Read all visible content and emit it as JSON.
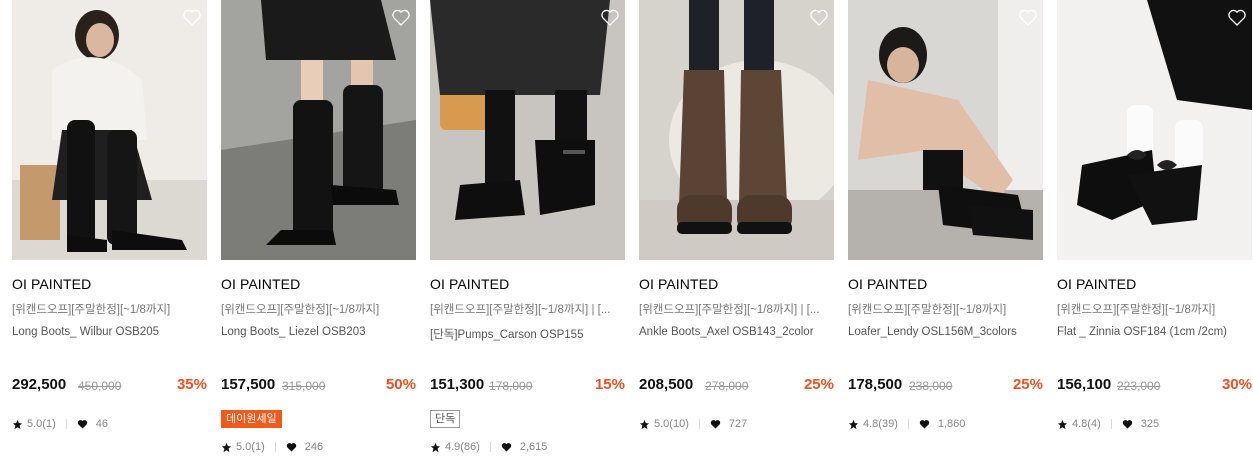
{
  "products": [
    {
      "brand": "OI PAINTED",
      "promo": "[위캔드오프][주말한정][~1/8까지]",
      "name": "Long Boots_ Wilbur OSB205",
      "price": "292,500",
      "original_price": "450,000",
      "discount": "35%",
      "badge": "",
      "rating": "5.0(1)",
      "likes": "46",
      "photo": "woman-in-white-sweater-black-knee-boots"
    },
    {
      "brand": "OI PAINTED",
      "promo": "[위캔드오프][주말한정][~1/8까지]",
      "name": "Long Boots_ Liezel OSB203",
      "price": "157,500",
      "original_price": "315,000",
      "discount": "50%",
      "badge": "데이원세일",
      "rating": "5.0(1)",
      "likes": "246",
      "photo": "black-knee-high-boots-on-floor"
    },
    {
      "brand": "OI PAINTED",
      "promo": "[위캔드오프][주말한정][~1/8까지] | [...",
      "name": "[단독]Pumps_Carson OSP155",
      "price": "151,300",
      "original_price": "178,000",
      "discount": "15%",
      "badge": "단독",
      "rating": "4.9(86)",
      "likes": "2,615",
      "photo": "black-mary-jane-pumps"
    },
    {
      "brand": "OI PAINTED",
      "promo": "[위캔드오프][주말한정][~1/8까지] | [...",
      "name": "Ankle Boots_Axel OSB143_2color",
      "price": "208,500",
      "original_price": "278,000",
      "discount": "25%",
      "badge": "",
      "rating": "5.0(10)",
      "likes": "727",
      "photo": "brown-ankle-boots-on-rug"
    },
    {
      "brand": "OI PAINTED",
      "promo": "[위캔드오프][주말한정][~1/8까지]",
      "name": "Loafer_Lendy OSL156M_3colors",
      "price": "178,500",
      "original_price": "238,000",
      "discount": "25%",
      "badge": "",
      "rating": "4.8(39)",
      "likes": "1,860",
      "photo": "woman-sitting-in-black-loafers"
    },
    {
      "brand": "OI PAINTED",
      "promo": "[위캔드오프][주말한정][~1/8까지]",
      "name": "Flat _ Zinnia OSF184 (1cm /2cm)",
      "price": "156,100",
      "original_price": "223,000",
      "discount": "30%",
      "badge": "",
      "rating": "4.8(4)",
      "likes": "325",
      "photo": "black-bow-flats-with-white-socks"
    }
  ],
  "colors": {
    "discount": "#f24e1e",
    "sale_badge": "#f05a1a",
    "price": "#111111",
    "muted": "#888888"
  },
  "icons": {
    "wishlist": "heart-outline-icon",
    "rating": "star-icon",
    "likes": "heart-filled-icon"
  }
}
